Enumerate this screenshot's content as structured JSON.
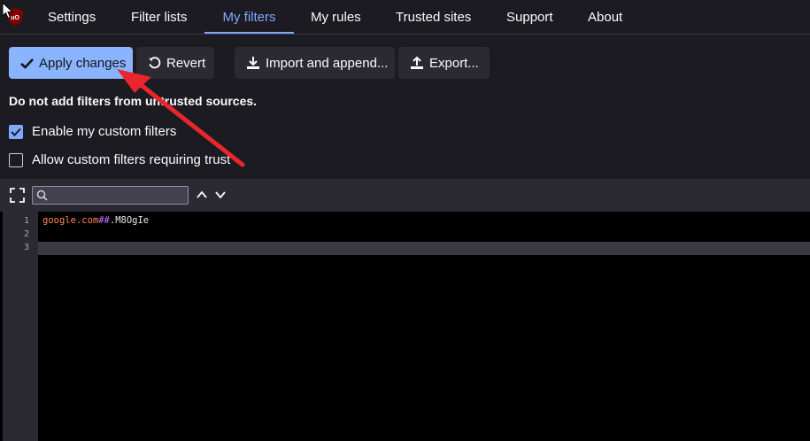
{
  "tabs": [
    {
      "label": "Settings",
      "active": false
    },
    {
      "label": "Filter lists",
      "active": false
    },
    {
      "label": "My filters",
      "active": true
    },
    {
      "label": "My rules",
      "active": false
    },
    {
      "label": "Trusted sites",
      "active": false
    },
    {
      "label": "Support",
      "active": false
    },
    {
      "label": "About",
      "active": false
    }
  ],
  "toolbar": {
    "apply_label": "Apply changes",
    "revert_label": "Revert",
    "import_label": "Import and append...",
    "export_label": "Export..."
  },
  "warning": "Do not add filters from untrusted sources.",
  "options": {
    "enable_custom": {
      "label": "Enable my custom filters",
      "checked": true
    },
    "allow_trusted": {
      "label": "Allow custom filters requiring trust",
      "checked": false
    }
  },
  "search": {
    "value": ""
  },
  "editor": {
    "line_numbers": [
      "1",
      "2",
      "3"
    ],
    "line1": {
      "domain": "google.com",
      "separator": "##",
      "selector": ".M8OgIe"
    }
  },
  "colors": {
    "accent": "#80a8ff",
    "primary_button": "#8ab4ff",
    "annotation_arrow": "#e8262c"
  },
  "icons": {
    "logo": "ublock-origin-logo",
    "apply": "checkmark-icon",
    "revert": "undo-icon",
    "import": "download-icon",
    "export": "upload-icon",
    "fullscreen": "fullscreen-icon",
    "search": "search-icon",
    "prev": "chevron-up-icon",
    "next": "chevron-down-icon"
  }
}
